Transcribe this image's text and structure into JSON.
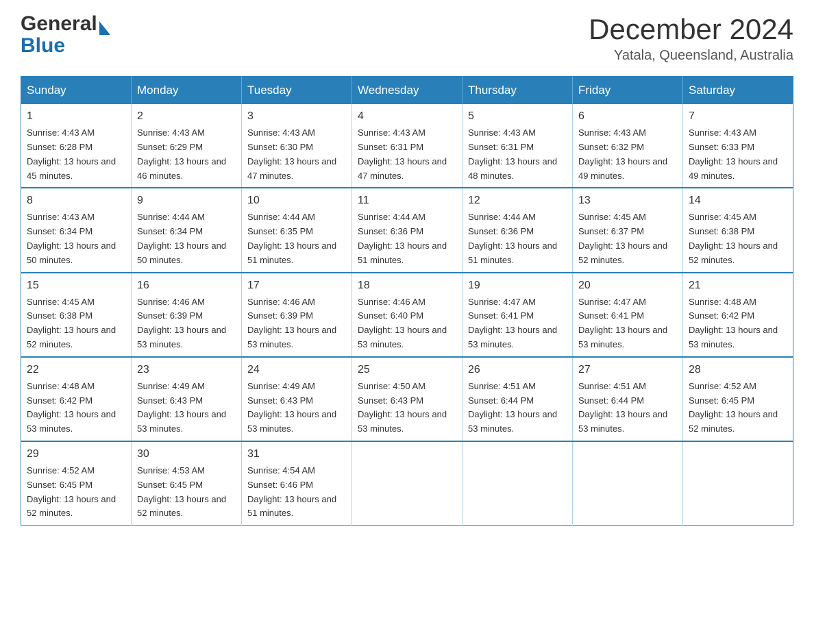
{
  "header": {
    "logo": {
      "general_text": "General",
      "blue_text": "Blue"
    },
    "title": "December 2024",
    "subtitle": "Yatala, Queensland, Australia"
  },
  "calendar": {
    "days_of_week": [
      "Sunday",
      "Monday",
      "Tuesday",
      "Wednesday",
      "Thursday",
      "Friday",
      "Saturday"
    ],
    "weeks": [
      [
        {
          "day": "1",
          "sunrise": "4:43 AM",
          "sunset": "6:28 PM",
          "daylight": "13 hours and 45 minutes."
        },
        {
          "day": "2",
          "sunrise": "4:43 AM",
          "sunset": "6:29 PM",
          "daylight": "13 hours and 46 minutes."
        },
        {
          "day": "3",
          "sunrise": "4:43 AM",
          "sunset": "6:30 PM",
          "daylight": "13 hours and 47 minutes."
        },
        {
          "day": "4",
          "sunrise": "4:43 AM",
          "sunset": "6:31 PM",
          "daylight": "13 hours and 47 minutes."
        },
        {
          "day": "5",
          "sunrise": "4:43 AM",
          "sunset": "6:31 PM",
          "daylight": "13 hours and 48 minutes."
        },
        {
          "day": "6",
          "sunrise": "4:43 AM",
          "sunset": "6:32 PM",
          "daylight": "13 hours and 49 minutes."
        },
        {
          "day": "7",
          "sunrise": "4:43 AM",
          "sunset": "6:33 PM",
          "daylight": "13 hours and 49 minutes."
        }
      ],
      [
        {
          "day": "8",
          "sunrise": "4:43 AM",
          "sunset": "6:34 PM",
          "daylight": "13 hours and 50 minutes."
        },
        {
          "day": "9",
          "sunrise": "4:44 AM",
          "sunset": "6:34 PM",
          "daylight": "13 hours and 50 minutes."
        },
        {
          "day": "10",
          "sunrise": "4:44 AM",
          "sunset": "6:35 PM",
          "daylight": "13 hours and 51 minutes."
        },
        {
          "day": "11",
          "sunrise": "4:44 AM",
          "sunset": "6:36 PM",
          "daylight": "13 hours and 51 minutes."
        },
        {
          "day": "12",
          "sunrise": "4:44 AM",
          "sunset": "6:36 PM",
          "daylight": "13 hours and 51 minutes."
        },
        {
          "day": "13",
          "sunrise": "4:45 AM",
          "sunset": "6:37 PM",
          "daylight": "13 hours and 52 minutes."
        },
        {
          "day": "14",
          "sunrise": "4:45 AM",
          "sunset": "6:38 PM",
          "daylight": "13 hours and 52 minutes."
        }
      ],
      [
        {
          "day": "15",
          "sunrise": "4:45 AM",
          "sunset": "6:38 PM",
          "daylight": "13 hours and 52 minutes."
        },
        {
          "day": "16",
          "sunrise": "4:46 AM",
          "sunset": "6:39 PM",
          "daylight": "13 hours and 53 minutes."
        },
        {
          "day": "17",
          "sunrise": "4:46 AM",
          "sunset": "6:39 PM",
          "daylight": "13 hours and 53 minutes."
        },
        {
          "day": "18",
          "sunrise": "4:46 AM",
          "sunset": "6:40 PM",
          "daylight": "13 hours and 53 minutes."
        },
        {
          "day": "19",
          "sunrise": "4:47 AM",
          "sunset": "6:41 PM",
          "daylight": "13 hours and 53 minutes."
        },
        {
          "day": "20",
          "sunrise": "4:47 AM",
          "sunset": "6:41 PM",
          "daylight": "13 hours and 53 minutes."
        },
        {
          "day": "21",
          "sunrise": "4:48 AM",
          "sunset": "6:42 PM",
          "daylight": "13 hours and 53 minutes."
        }
      ],
      [
        {
          "day": "22",
          "sunrise": "4:48 AM",
          "sunset": "6:42 PM",
          "daylight": "13 hours and 53 minutes."
        },
        {
          "day": "23",
          "sunrise": "4:49 AM",
          "sunset": "6:43 PM",
          "daylight": "13 hours and 53 minutes."
        },
        {
          "day": "24",
          "sunrise": "4:49 AM",
          "sunset": "6:43 PM",
          "daylight": "13 hours and 53 minutes."
        },
        {
          "day": "25",
          "sunrise": "4:50 AM",
          "sunset": "6:43 PM",
          "daylight": "13 hours and 53 minutes."
        },
        {
          "day": "26",
          "sunrise": "4:51 AM",
          "sunset": "6:44 PM",
          "daylight": "13 hours and 53 minutes."
        },
        {
          "day": "27",
          "sunrise": "4:51 AM",
          "sunset": "6:44 PM",
          "daylight": "13 hours and 53 minutes."
        },
        {
          "day": "28",
          "sunrise": "4:52 AM",
          "sunset": "6:45 PM",
          "daylight": "13 hours and 52 minutes."
        }
      ],
      [
        {
          "day": "29",
          "sunrise": "4:52 AM",
          "sunset": "6:45 PM",
          "daylight": "13 hours and 52 minutes."
        },
        {
          "day": "30",
          "sunrise": "4:53 AM",
          "sunset": "6:45 PM",
          "daylight": "13 hours and 52 minutes."
        },
        {
          "day": "31",
          "sunrise": "4:54 AM",
          "sunset": "6:46 PM",
          "daylight": "13 hours and 51 minutes."
        },
        null,
        null,
        null,
        null
      ]
    ]
  },
  "labels": {
    "sunrise_prefix": "Sunrise: ",
    "sunset_prefix": "Sunset: ",
    "daylight_prefix": "Daylight: "
  }
}
